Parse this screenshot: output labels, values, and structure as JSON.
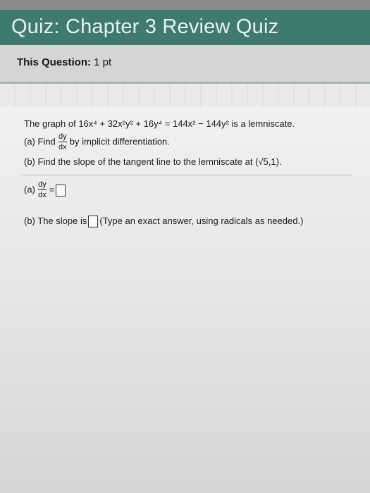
{
  "quiz": {
    "title": "Quiz: Chapter 3 Review Quiz"
  },
  "question": {
    "label": "This Question:",
    "points": "1 pt"
  },
  "problem": {
    "statement": "The graph of 16x⁴ + 32x²y² + 16y⁴ = 144x² − 144y² is a lemniscate.",
    "part_a_prefix": "(a) Find",
    "part_a_suffix": "by implicit differentiation.",
    "part_b": "(b) Find the slope of the tangent line to the lemniscate at (√5,1).",
    "dy": "dy",
    "dx": "dx"
  },
  "answers": {
    "a_label": "(a)",
    "a_eq": "=",
    "b_prefix": "(b) The slope is",
    "b_hint": "(Type an exact answer, using radicals as needed.)"
  }
}
